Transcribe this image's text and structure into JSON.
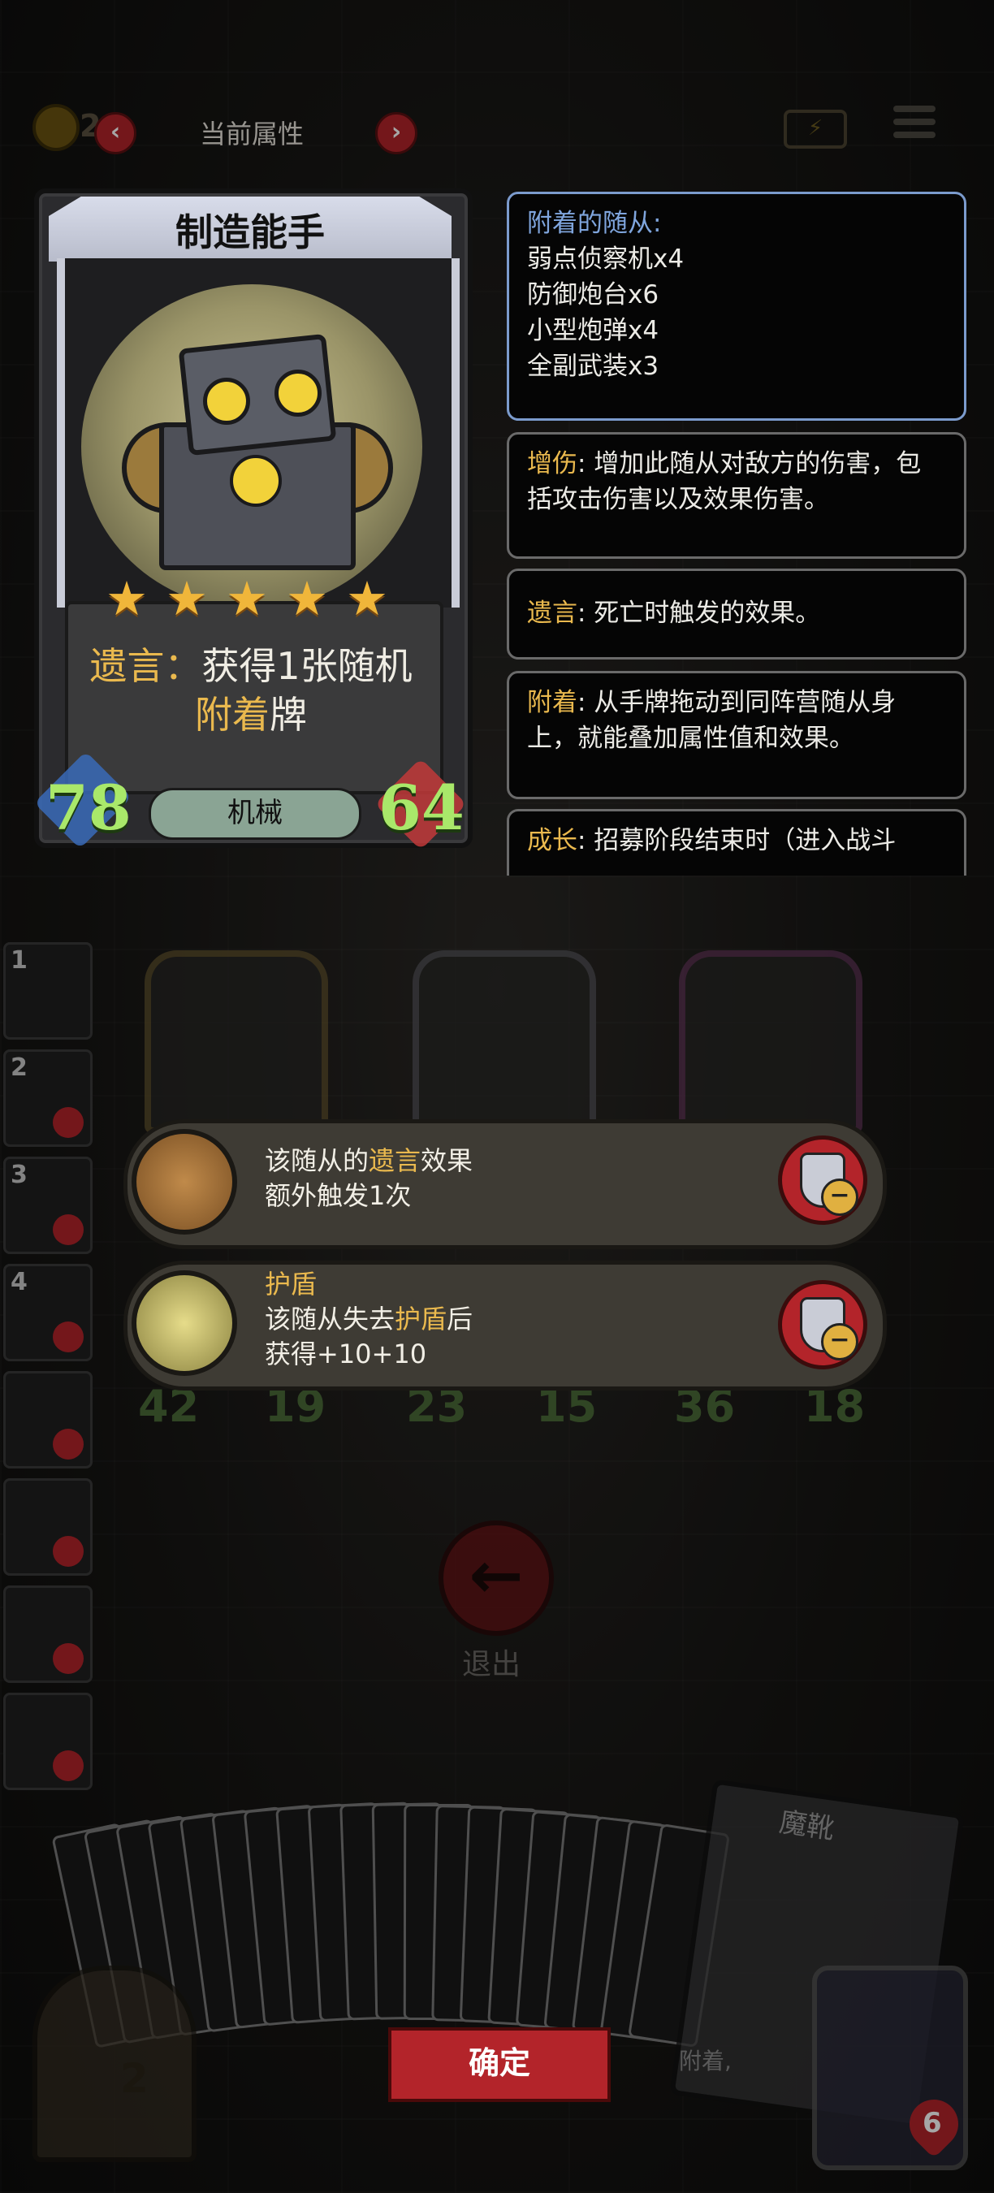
{
  "topbar": {
    "coin_count": "2",
    "prev_label": "‹",
    "next_label": "›",
    "title": "当前属性"
  },
  "card": {
    "name": "制造能手",
    "stars": 5,
    "effect_prefix": "遗言：",
    "effect_mid": "获得1张随机",
    "effect_keyword": "附着",
    "effect_suffix": "牌",
    "attack": "78",
    "health": "64",
    "tribe": "机械"
  },
  "attached": {
    "title": "附着的随从:",
    "items": [
      "弱点侦察机x4",
      "防御炮台x6",
      "小型炮弹x4",
      "全副武装x3"
    ]
  },
  "glossary": [
    {
      "term": "增伤",
      "text": ": 增加此随从对敌方的伤害，包括攻击伤害以及效果伤害。"
    },
    {
      "term": "遗言",
      "text": ": 死亡时触发的效果。"
    },
    {
      "term": "附着",
      "text": ": 从手牌拖动到同阵营随从身上，就能叠加属性值和效果。"
    },
    {
      "term": "成长",
      "text": ": 招募阶段结束时（进入战斗"
    }
  ],
  "side_slots": [
    "1",
    "2",
    "3",
    "4",
    "",
    "",
    "",
    ""
  ],
  "board_stats": [
    {
      "atk": "42",
      "hp": "19"
    },
    {
      "atk": "23",
      "hp": "15"
    },
    {
      "atk": "36",
      "hp": "18"
    }
  ],
  "enchants": [
    {
      "line1_pre": "该随从的",
      "line1_key": "遗言",
      "line1_post": "效果",
      "line2": "额外触发1次",
      "line3": ""
    },
    {
      "title": "护盾",
      "line1_pre": "该随从失去",
      "line1_key": "护盾",
      "line1_post": "后",
      "line2": "获得+10+10"
    }
  ],
  "exit_label": "退出",
  "hand": {
    "big_card_title": "魔靴",
    "big_card_text": "附着,",
    "chest_number": "2",
    "owl_health": "6"
  },
  "confirm_label": "确定",
  "colors": {
    "accent_red": "#b3242a",
    "keyword_gold": "#eab94e",
    "panel_blue": "#7fa5dd",
    "stat_green": "#a9e86a"
  }
}
